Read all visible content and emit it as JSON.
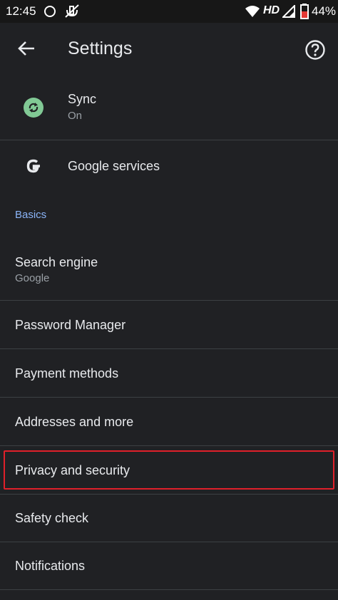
{
  "status_bar": {
    "time": "12:45",
    "network": "HD",
    "battery": "44%"
  },
  "app_bar": {
    "title": "Settings"
  },
  "account": {
    "sync": {
      "title": "Sync",
      "subtitle": "On"
    },
    "google_services": {
      "title": "Google services"
    }
  },
  "basics": {
    "header": "Basics",
    "items": [
      {
        "title": "Search engine",
        "subtitle": "Google"
      },
      {
        "title": "Password Manager"
      },
      {
        "title": "Payment methods"
      },
      {
        "title": "Addresses and more"
      },
      {
        "title": "Privacy and security"
      },
      {
        "title": "Safety check"
      },
      {
        "title": "Notifications"
      }
    ]
  },
  "colors": {
    "background": "#202124",
    "accent": "#8ab4f8",
    "sync_green": "#81c995",
    "highlight_red": "#e0202a"
  }
}
